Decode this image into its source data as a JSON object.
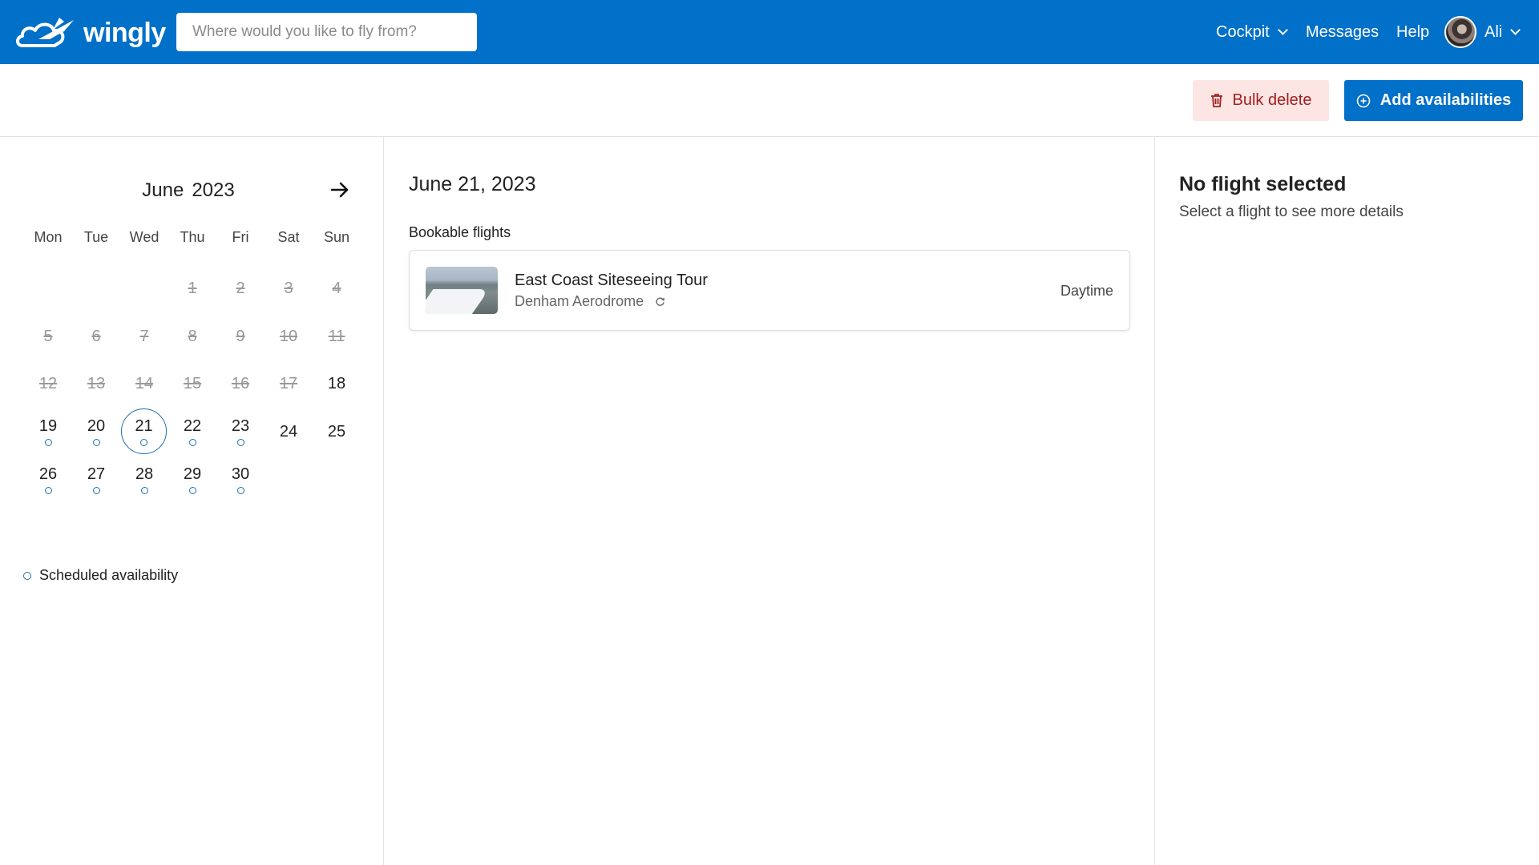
{
  "header": {
    "logo_text": "wingly",
    "search_placeholder": "Where would you like to fly from?",
    "nav": {
      "cockpit": "Cockpit",
      "messages": "Messages",
      "help": "Help",
      "user": "Ali"
    }
  },
  "toolbar": {
    "bulk_delete": "Bulk delete",
    "add_availabilities": "Add availabilities"
  },
  "calendar": {
    "month": "June",
    "year": "2023",
    "weekdays": [
      "Mon",
      "Tue",
      "Wed",
      "Thu",
      "Fri",
      "Sat",
      "Sun"
    ],
    "first_weekday_index": 3,
    "days_in_month": 30,
    "past_days_through": 17,
    "selected_day": 21,
    "availability_days": [
      19,
      20,
      21,
      22,
      23,
      26,
      27,
      28,
      29,
      30
    ],
    "legend": "Scheduled availability"
  },
  "main": {
    "date": "June 21, 2023",
    "section_title": "Bookable flights",
    "flights": [
      {
        "name": "East Coast Siteseeing Tour",
        "location": "Denham Aerodrome",
        "time": "Daytime",
        "recurring_icon": "refresh-icon"
      }
    ]
  },
  "details": {
    "title": "No flight selected",
    "subtitle": "Select a flight to see more details"
  },
  "colors": {
    "brand": "#0070c9",
    "danger_bg": "#fde5e4",
    "danger_text": "#a11f1f",
    "availability_dot": "#1f6fb0"
  }
}
